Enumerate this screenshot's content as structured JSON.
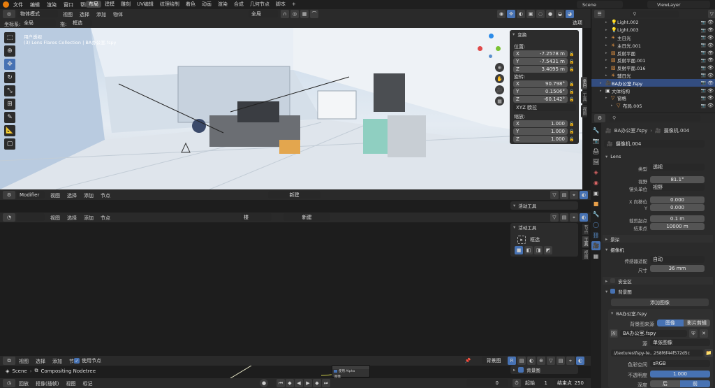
{
  "topbar": {
    "menus": [
      "文件",
      "编辑",
      "渲染",
      "窗口",
      "帮助"
    ],
    "workspaces": [
      "布局",
      "建模",
      "雕刻",
      "UV编辑",
      "纹理绘制",
      "着色",
      "动画",
      "渲染",
      "合成",
      "几何节点",
      "脚本"
    ],
    "add_tab": "+",
    "scene": "Scene",
    "view_layer": "ViewLayer"
  },
  "viewport_header": {
    "mode": "物体模式",
    "menus": [
      "视图",
      "选择",
      "添加",
      "物体"
    ],
    "pivot": "全局",
    "coord_label": "坐标系:",
    "coord_value": "全局",
    "drag_label": "拖:",
    "select_value": "框选",
    "options": "选项"
  },
  "viewport_overlay": {
    "view_name": "用户透视",
    "collection": "(3) Lens Flares Collection | BA办公室.fspy"
  },
  "npanel": {
    "title": "变换",
    "location_label": "位置:",
    "location": [
      {
        "axis": "X",
        "value": "-7.2578 m"
      },
      {
        "axis": "Y",
        "value": "-7.5431 m"
      },
      {
        "axis": "Z",
        "value": "3.4095 m"
      }
    ],
    "rotation_label": "旋转:",
    "rotation": [
      {
        "axis": "X",
        "value": "90.798°"
      },
      {
        "axis": "Y",
        "value": "0.1506°"
      },
      {
        "axis": "Z",
        "value": "-60.142°"
      }
    ],
    "rotation_mode": "XYZ 欧拉",
    "scale_label": "缩放:",
    "scale": [
      {
        "axis": "X",
        "value": "1.000"
      },
      {
        "axis": "Y",
        "value": "1.000"
      },
      {
        "axis": "Z",
        "value": "1.000"
      }
    ],
    "tabs": [
      "条目",
      "工具",
      "视图"
    ]
  },
  "outliner": {
    "items": [
      {
        "name": "Light.002",
        "indent": 2,
        "icon": "light"
      },
      {
        "name": "Light.003",
        "indent": 2,
        "icon": "light"
      },
      {
        "name": "主日光",
        "indent": 2,
        "icon": "sun"
      },
      {
        "name": "主日光.001",
        "indent": 2,
        "icon": "sun"
      },
      {
        "name": "反射平面",
        "indent": 2,
        "icon": "probe"
      },
      {
        "name": "反射平面.001",
        "indent": 2,
        "icon": "probe"
      },
      {
        "name": "反射平面.016",
        "indent": 2,
        "icon": "probe"
      },
      {
        "name": "辅日光",
        "indent": 2,
        "icon": "sun"
      },
      {
        "name": "BA办公室.fspy",
        "indent": 1,
        "icon": "camera",
        "selected": true
      },
      {
        "name": "大体结构",
        "indent": 1,
        "icon": "collection"
      },
      {
        "name": "窗格",
        "indent": 2,
        "icon": "mesh"
      },
      {
        "name": "布局.005",
        "indent": 3,
        "icon": "mesh"
      }
    ]
  },
  "properties": {
    "breadcrumb_obj": "BA办公室.fspy",
    "breadcrumb_data": "摄像机.004",
    "data_name": "摄像机.004",
    "lens_section": "Lens",
    "type_label": "类型",
    "type_value": "透视",
    "fov_label": "视野",
    "fov_value": "81.1°",
    "lens_unit_label": "镜头单位",
    "lens_unit_value": "视野",
    "shift_x_label": "X 向移位",
    "shift_x_value": "0.000",
    "shift_y_label": "Y",
    "shift_y_value": "0.000",
    "clip_start_label": "裁剪起点",
    "clip_start_value": "0.1 m",
    "clip_end_label": "结束点",
    "clip_end_value": "10000 m",
    "dof_section": "景深",
    "camera_section": "摄像机",
    "sensor_fit_label": "传感器适配",
    "sensor_fit_value": "自动",
    "size_label": "尺寸",
    "size_value": "36 mm",
    "safe_section": "安全区",
    "bg_section": "背景图",
    "add_image": "添加图像",
    "bg_item": "BA办公室.fspy",
    "source_label": "背景图来源",
    "source_image": "图像",
    "source_clip": "影片剪辑",
    "image_name": "BA办公室.fspy",
    "src_label": "源",
    "src_value": "单张图像",
    "filepath": "//textures\\fspy-te...258f6f44f572d5c",
    "colorspace_label": "色彩空间",
    "colorspace_value": "sRGB",
    "opacity_label": "不透明度",
    "opacity_value": "1.000",
    "depth_label": "深度",
    "depth_front": "后",
    "depth_back": "前"
  },
  "middle_editor": {
    "mode": "Modifier",
    "menus": [
      "视图",
      "选择",
      "添加",
      "节点"
    ],
    "new_label": "新建",
    "side_title": "活动工具"
  },
  "node_editor": {
    "menus": [
      "视图",
      "选择",
      "添加",
      "节点"
    ],
    "object_field": "楼",
    "new_label": "新建",
    "side_title": "活动工具",
    "tool_label": "框选",
    "side_tabs": [
      "节点",
      "工具",
      "视图"
    ]
  },
  "compositor": {
    "menus": [
      "视图",
      "选择",
      "添加",
      "节点"
    ],
    "use_nodes": "使用节点",
    "backdrop": "背景图",
    "breadcrumb_scene": "Scene",
    "breadcrumb_tree": "Compositing Nodetree",
    "node_alpha": "使用 Alpha",
    "node_image": "图像",
    "side_title": "背景图"
  },
  "timeline": {
    "menus": [
      "回放",
      "抠像(插帧)",
      "视图",
      "标记"
    ],
    "current_frame": "0",
    "start_label": "起始",
    "start_value": "1",
    "end_label": "结束点",
    "end_value": "250"
  }
}
